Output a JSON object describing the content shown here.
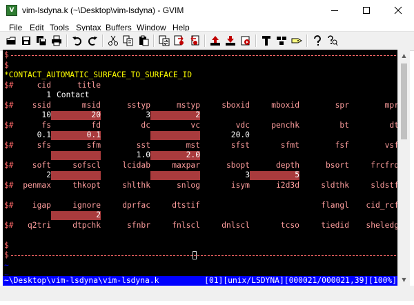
{
  "window": {
    "title": "vim-lsdyna.k (~\\Desktop\\vim-lsdyna) - GVIM",
    "app_icon": "gvim-icon",
    "app_icon_glyph": "V",
    "controls": [
      "minimize-icon",
      "maximize-icon",
      "close-icon"
    ]
  },
  "menubar": [
    "File",
    "Edit",
    "Tools",
    "Syntax",
    "Buffers",
    "Window",
    "Help"
  ],
  "toolbar": [
    "open-icon",
    "save-icon",
    "save-all-icon",
    "print-icon",
    "undo-icon",
    "redo-icon",
    "cut-icon",
    "copy-icon",
    "paste-icon",
    "find-replace-icon",
    "find-next-icon",
    "find-prev-icon",
    "load-session-icon",
    "save-session-icon",
    "run-script-icon",
    "make-icon",
    "build-tags-icon",
    "jump-to-tag-icon",
    "help-icon",
    "find-help-icon"
  ],
  "colors": {
    "background": "#000000",
    "comment_marker": "#ff6868",
    "keyword": "#ffff00",
    "label": "#ff9e9e",
    "value": "#ffffff",
    "field_highlight": "#a93b3d",
    "empty_line_marker": "#0000ff",
    "statusline_bg": "#0000ff"
  },
  "editor": {
    "lines": [
      {
        "type": "rule"
      },
      {
        "type": "marker",
        "text": "$"
      },
      {
        "type": "keyword",
        "text": "*CONTACT_AUTOMATIC_SURFACE_TO_SURFACE_ID"
      },
      {
        "type": "labels",
        "labels": [
          "cid",
          "title"
        ]
      },
      {
        "type": "values",
        "values": [
          "1",
          "Contact"
        ],
        "highlight": [
          false,
          false
        ]
      },
      {
        "type": "labels",
        "labels": [
          "ssid",
          "msid",
          "sstyp",
          "mstyp",
          "sboxid",
          "mboxid",
          "spr",
          "mpr"
        ]
      },
      {
        "type": "values",
        "values": [
          "10",
          "20",
          "3",
          "2",
          "",
          "",
          "",
          ""
        ],
        "highlight": [
          false,
          true,
          false,
          true,
          false,
          false,
          false,
          false
        ]
      },
      {
        "type": "labels",
        "labels": [
          "fs",
          "fd",
          "dc",
          "vc",
          "vdc",
          "penchk",
          "bt",
          "dt"
        ]
      },
      {
        "type": "values",
        "values": [
          "0.1",
          "0.1",
          "",
          "",
          "20.0",
          "",
          "",
          ""
        ],
        "highlight": [
          false,
          true,
          false,
          true,
          false,
          false,
          false,
          false
        ]
      },
      {
        "type": "labels",
        "labels": [
          "sfs",
          "sfm",
          "sst",
          "mst",
          "sfst",
          "sfmt",
          "fsf",
          "vsf"
        ]
      },
      {
        "type": "values",
        "values": [
          "",
          "",
          "1.0",
          "2.0",
          "",
          "",
          "",
          ""
        ],
        "highlight": [
          false,
          true,
          false,
          true,
          false,
          false,
          false,
          false
        ]
      },
      {
        "type": "labels",
        "labels": [
          "soft",
          "sofscl",
          "lcidab",
          "maxpar",
          "sbopt",
          "depth",
          "bsort",
          "frcfrq"
        ]
      },
      {
        "type": "values",
        "values": [
          "2",
          "",
          "",
          "",
          "3",
          "5",
          "",
          ""
        ],
        "highlight": [
          false,
          true,
          false,
          true,
          false,
          true,
          false,
          false
        ]
      },
      {
        "type": "labels",
        "labels": [
          "penmax",
          "thkopt",
          "shlthk",
          "snlog",
          "isym",
          "i2d3d",
          "sldthk",
          "sldstf"
        ]
      },
      {
        "type": "blank"
      },
      {
        "type": "labels",
        "labels": [
          "igap",
          "ignore",
          "dprfac",
          "dtstif",
          "",
          "",
          "flangl",
          "cid_rcf"
        ]
      },
      {
        "type": "values",
        "values": [
          "",
          "2",
          "",
          "",
          "",
          "",
          "",
          ""
        ],
        "highlight": [
          false,
          true,
          false,
          false,
          false,
          false,
          false,
          false
        ]
      },
      {
        "type": "labels",
        "labels": [
          "q2tri",
          "dtpchk",
          "sfnbr",
          "fnlscl",
          "dnlscl",
          "tcso",
          "tiedid",
          "sheledg"
        ]
      },
      {
        "type": "blank"
      },
      {
        "type": "marker",
        "text": "$"
      },
      {
        "type": "rule",
        "cursor": true
      },
      {
        "type": "empty",
        "text": "~"
      },
      {
        "type": "empty",
        "text": "~"
      }
    ]
  },
  "statusline": {
    "path": "~\\Desktop\\vim-lsdyna\\vim-lsdyna.k",
    "info": "[01][unix/LSDYNA][000021/000021,39][100%]"
  },
  "scrollbar": {
    "position": 1.0
  }
}
